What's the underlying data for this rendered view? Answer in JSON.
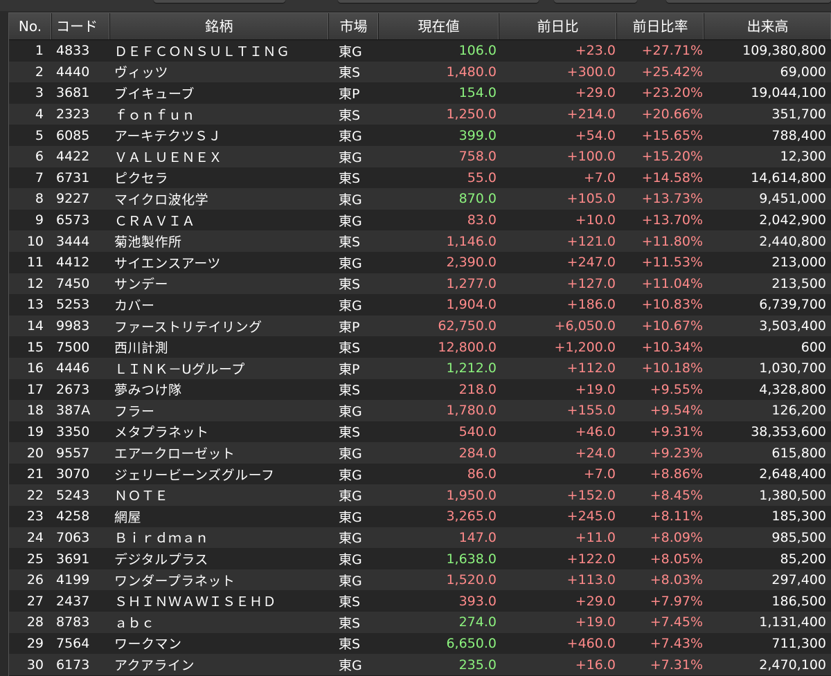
{
  "colors": {
    "up_red": "#ff8a8a",
    "price_green": "#8cf27e",
    "text_white": "#ffffff"
  },
  "header": {
    "no": "No.",
    "code": "コード",
    "name": "銘柄",
    "market": "市場",
    "price": "現在値",
    "change": "前日比",
    "rate": "前日比率",
    "volume": "出来高"
  },
  "rows": [
    {
      "no": "1",
      "code": "4833",
      "name": "ＤＥＦＣＯＮＳＵＬＴＩＮＧ",
      "market": "東G",
      "price": "106.0",
      "price_color": "green",
      "change": "+23.0",
      "rate": "+27.71%",
      "volume": "109,380,800"
    },
    {
      "no": "2",
      "code": "4440",
      "name": "ヴィッツ",
      "market": "東S",
      "price": "1,480.0",
      "price_color": "up",
      "change": "+300.0",
      "rate": "+25.42%",
      "volume": "69,000"
    },
    {
      "no": "3",
      "code": "3681",
      "name": "ブイキューブ",
      "market": "東P",
      "price": "154.0",
      "price_color": "green",
      "change": "+29.0",
      "rate": "+23.20%",
      "volume": "19,044,100"
    },
    {
      "no": "4",
      "code": "2323",
      "name": "ｆｏｎｆｕｎ",
      "market": "東S",
      "price": "1,250.0",
      "price_color": "up",
      "change": "+214.0",
      "rate": "+20.66%",
      "volume": "351,700"
    },
    {
      "no": "5",
      "code": "6085",
      "name": "アーキテクツＳＪ",
      "market": "東G",
      "price": "399.0",
      "price_color": "green",
      "change": "+54.0",
      "rate": "+15.65%",
      "volume": "788,400"
    },
    {
      "no": "6",
      "code": "4422",
      "name": "ＶＡＬＵＥＮＥＸ",
      "market": "東G",
      "price": "758.0",
      "price_color": "up",
      "change": "+100.0",
      "rate": "+15.20%",
      "volume": "12,300"
    },
    {
      "no": "7",
      "code": "6731",
      "name": "ピクセラ",
      "market": "東S",
      "price": "55.0",
      "price_color": "up",
      "change": "+7.0",
      "rate": "+14.58%",
      "volume": "14,614,800"
    },
    {
      "no": "8",
      "code": "9227",
      "name": "マイクロ波化学",
      "market": "東G",
      "price": "870.0",
      "price_color": "green",
      "change": "+105.0",
      "rate": "+13.73%",
      "volume": "9,451,000"
    },
    {
      "no": "9",
      "code": "6573",
      "name": "ＣＲＡＶＩＡ",
      "market": "東G",
      "price": "83.0",
      "price_color": "up",
      "change": "+10.0",
      "rate": "+13.70%",
      "volume": "2,042,900"
    },
    {
      "no": "10",
      "code": "3444",
      "name": "菊池製作所",
      "market": "東S",
      "price": "1,146.0",
      "price_color": "up",
      "change": "+121.0",
      "rate": "+11.80%",
      "volume": "2,440,800"
    },
    {
      "no": "11",
      "code": "4412",
      "name": "サイエンスアーツ",
      "market": "東G",
      "price": "2,390.0",
      "price_color": "up",
      "change": "+247.0",
      "rate": "+11.53%",
      "volume": "213,000"
    },
    {
      "no": "12",
      "code": "7450",
      "name": "サンデー",
      "market": "東S",
      "price": "1,277.0",
      "price_color": "up",
      "change": "+127.0",
      "rate": "+11.04%",
      "volume": "213,500"
    },
    {
      "no": "13",
      "code": "5253",
      "name": "カバー",
      "market": "東G",
      "price": "1,904.0",
      "price_color": "up",
      "change": "+186.0",
      "rate": "+10.83%",
      "volume": "6,739,700"
    },
    {
      "no": "14",
      "code": "9983",
      "name": "ファーストリテイリング",
      "market": "東P",
      "price": "62,750.0",
      "price_color": "up",
      "change": "+6,050.0",
      "rate": "+10.67%",
      "volume": "3,503,400"
    },
    {
      "no": "15",
      "code": "7500",
      "name": "西川計測",
      "market": "東S",
      "price": "12,800.0",
      "price_color": "up",
      "change": "+1,200.0",
      "rate": "+10.34%",
      "volume": "600"
    },
    {
      "no": "16",
      "code": "4446",
      "name": "ＬＩＮＫ－Uグループ",
      "market": "東P",
      "price": "1,212.0",
      "price_color": "green",
      "change": "+112.0",
      "rate": "+10.18%",
      "volume": "1,030,700"
    },
    {
      "no": "17",
      "code": "2673",
      "name": "夢みつけ隊",
      "market": "東S",
      "price": "218.0",
      "price_color": "up",
      "change": "+19.0",
      "rate": "+9.55%",
      "volume": "4,328,800"
    },
    {
      "no": "18",
      "code": "387A",
      "name": "フラー",
      "market": "東G",
      "price": "1,780.0",
      "price_color": "up",
      "change": "+155.0",
      "rate": "+9.54%",
      "volume": "126,200"
    },
    {
      "no": "19",
      "code": "3350",
      "name": "メタプラネット",
      "market": "東S",
      "price": "540.0",
      "price_color": "up",
      "change": "+46.0",
      "rate": "+9.31%",
      "volume": "38,353,600"
    },
    {
      "no": "20",
      "code": "9557",
      "name": "エアークローゼット",
      "market": "東G",
      "price": "284.0",
      "price_color": "up",
      "change": "+24.0",
      "rate": "+9.23%",
      "volume": "615,800"
    },
    {
      "no": "21",
      "code": "3070",
      "name": "ジェリービーンズグルーフ",
      "market": "東G",
      "price": "86.0",
      "price_color": "up",
      "change": "+7.0",
      "rate": "+8.86%",
      "volume": "2,648,400"
    },
    {
      "no": "22",
      "code": "5243",
      "name": "ＮＯＴＥ",
      "market": "東G",
      "price": "1,950.0",
      "price_color": "up",
      "change": "+152.0",
      "rate": "+8.45%",
      "volume": "1,380,500"
    },
    {
      "no": "23",
      "code": "4258",
      "name": "網屋",
      "market": "東G",
      "price": "3,265.0",
      "price_color": "up",
      "change": "+245.0",
      "rate": "+8.11%",
      "volume": "185,300"
    },
    {
      "no": "24",
      "code": "7063",
      "name": "Ｂｉｒｄｍａｎ",
      "market": "東G",
      "price": "147.0",
      "price_color": "up",
      "change": "+11.0",
      "rate": "+8.09%",
      "volume": "985,500"
    },
    {
      "no": "25",
      "code": "3691",
      "name": "デジタルプラス",
      "market": "東G",
      "price": "1,638.0",
      "price_color": "green",
      "change": "+122.0",
      "rate": "+8.05%",
      "volume": "85,200"
    },
    {
      "no": "26",
      "code": "4199",
      "name": "ワンダープラネット",
      "market": "東G",
      "price": "1,520.0",
      "price_color": "up",
      "change": "+113.0",
      "rate": "+8.03%",
      "volume": "297,400"
    },
    {
      "no": "27",
      "code": "2437",
      "name": "ＳＨＩＮＷＡＷＩＳＥＨＤ",
      "market": "東S",
      "price": "393.0",
      "price_color": "up",
      "change": "+29.0",
      "rate": "+7.97%",
      "volume": "186,500"
    },
    {
      "no": "28",
      "code": "8783",
      "name": "ａｂｃ",
      "market": "東S",
      "price": "274.0",
      "price_color": "green",
      "change": "+19.0",
      "rate": "+7.45%",
      "volume": "1,131,400"
    },
    {
      "no": "29",
      "code": "7564",
      "name": "ワークマン",
      "market": "東S",
      "price": "6,650.0",
      "price_color": "green",
      "change": "+460.0",
      "rate": "+7.43%",
      "volume": "711,300"
    },
    {
      "no": "30",
      "code": "6173",
      "name": "アクアライン",
      "market": "東G",
      "price": "235.0",
      "price_color": "green",
      "change": "+16.0",
      "rate": "+7.31%",
      "volume": "2,470,100"
    }
  ]
}
